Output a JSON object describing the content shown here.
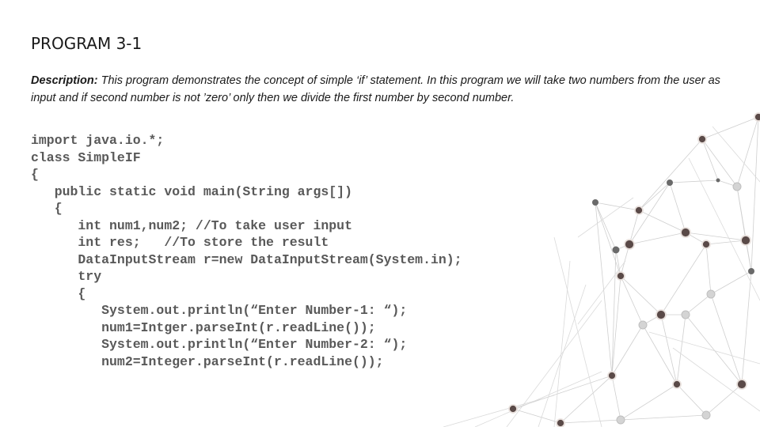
{
  "slide": {
    "title": "PROGRAM 3-1",
    "description": {
      "label": "Description:",
      "text": " This program demonstrates the concept of simple ‘if’ statement. In this program we will take two numbers from the user as input and if second number is not ’zero’ only then we divide the first number by second number."
    },
    "code_lines": [
      "import java.io.*;",
      "class SimpleIF",
      "{",
      "   public static void main(String args[])",
      "   {",
      "      int num1,num2; //To take user input",
      "      int res;   //To store the result",
      "      DataInputStream r=new DataInputStream(System.in);",
      "      try",
      "      {",
      "         System.out.println(“Enter Number-1: “);",
      "         num1=Intger.parseInt(r.readLine());",
      "         System.out.println(“Enter Number-2: “);",
      "         num2=Integer.parseInt(r.readLine());"
    ]
  },
  "colors": {
    "text": "#1a1a1a",
    "code": "#595959",
    "network_line": "#c9c9c9",
    "node_dark": "#5a4a48",
    "node_light": "#d0d0d0"
  }
}
